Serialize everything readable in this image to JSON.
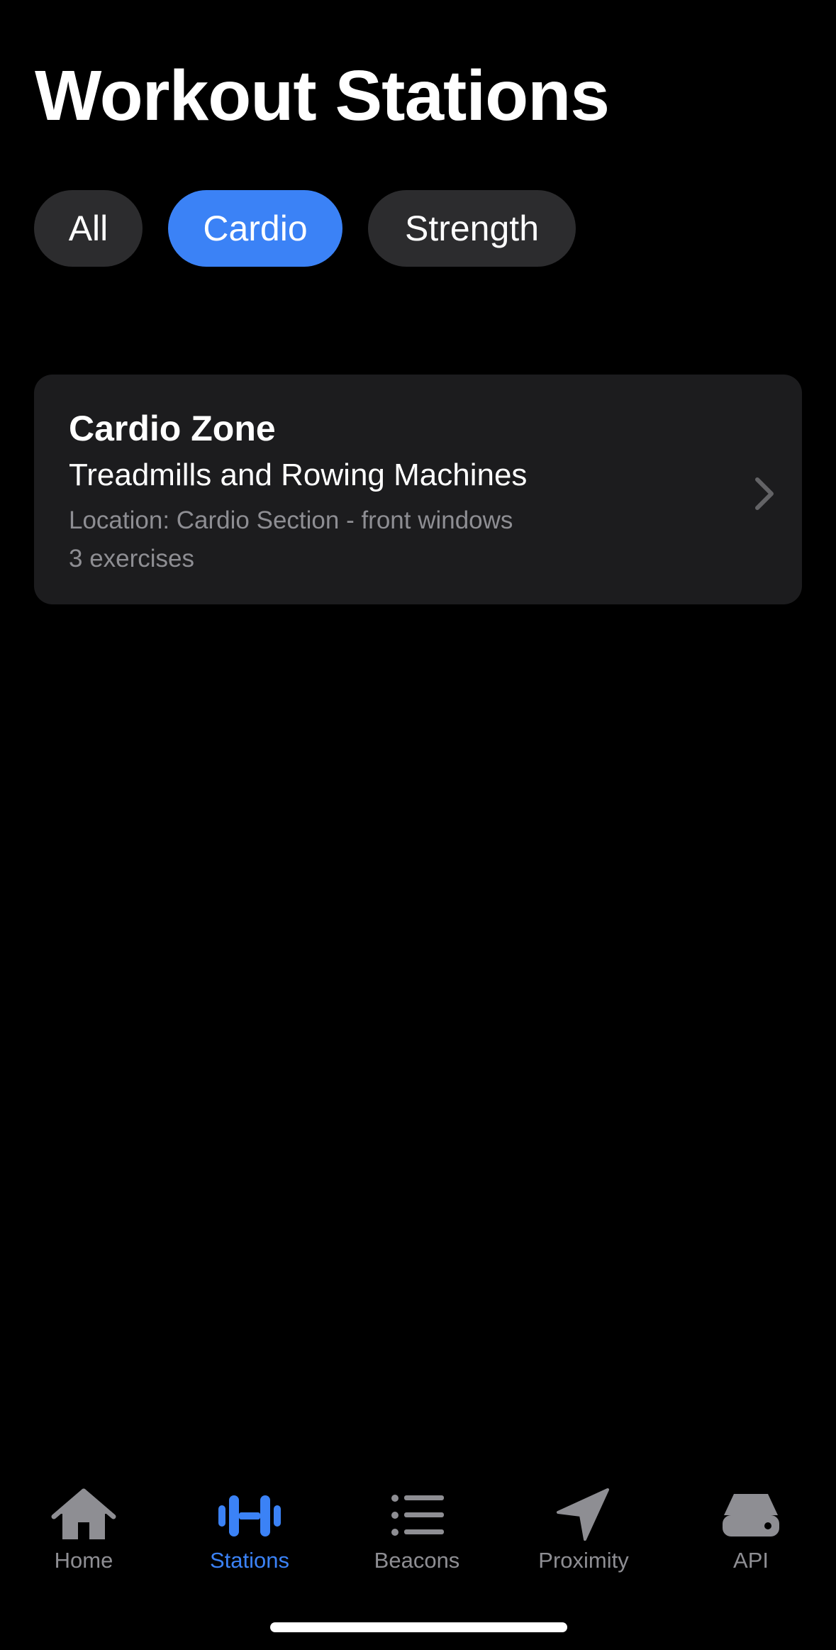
{
  "header": {
    "title": "Workout Stations"
  },
  "filters": {
    "items": [
      {
        "label": "All",
        "selected": false
      },
      {
        "label": "Cardio",
        "selected": true
      },
      {
        "label": "Strength",
        "selected": false
      }
    ]
  },
  "stations": [
    {
      "title": "Cardio Zone",
      "subtitle": "Treadmills and Rowing Machines",
      "location": "Location: Cardio Section - front windows",
      "exercise_count": "3 exercises",
      "action_icon": "chevron-right-icon"
    }
  ],
  "tabbar": {
    "items": [
      {
        "label": "Home",
        "icon": "house-icon",
        "active": false
      },
      {
        "label": "Stations",
        "icon": "dumbbell-icon",
        "active": true
      },
      {
        "label": "Beacons",
        "icon": "list-icon",
        "active": false
      },
      {
        "label": "Proximity",
        "icon": "location-arrow-icon",
        "active": false
      },
      {
        "label": "API",
        "icon": "server-icon",
        "active": false
      }
    ]
  },
  "colors": {
    "background": "#000000",
    "accent": "#3b82f6",
    "card": "#1c1c1e",
    "chip": "#2c2c2e",
    "secondary_text": "#8e8e93"
  }
}
